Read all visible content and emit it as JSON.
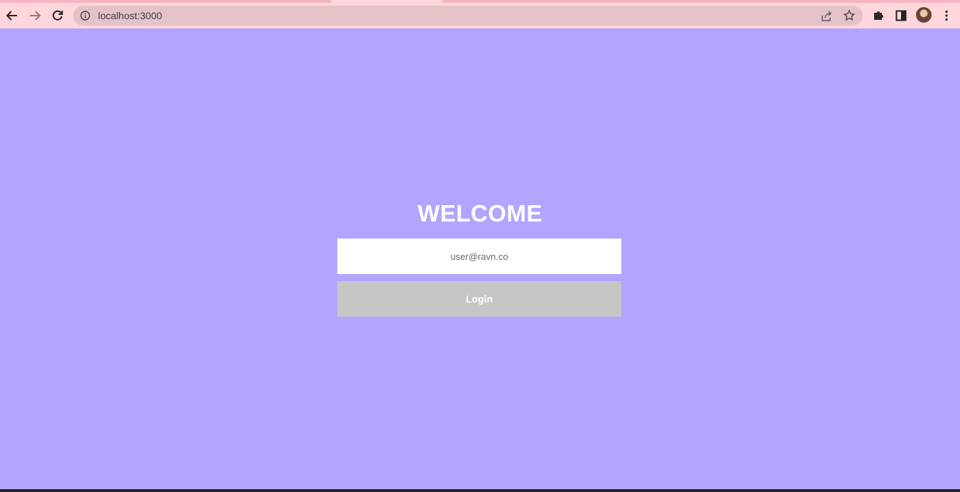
{
  "browser": {
    "url": "localhost:3000",
    "icons": {
      "back": "back-arrow-icon",
      "forward": "forward-arrow-icon",
      "reload": "reload-icon",
      "site_info": "info-icon",
      "share": "share-icon",
      "bookmark": "star-icon",
      "extensions": "puzzle-icon",
      "side_panel": "side-panel-icon",
      "menu": "kebab-menu-icon"
    },
    "colors": {
      "toolbar": "#ffd6dc",
      "omnibox": "#e4c3c8"
    }
  },
  "page": {
    "background": "#b3a4ff",
    "title": "WELCOME",
    "email_placeholder": "user@ravn.co",
    "login_label": "Login",
    "login_button_color": "#c6c6c6"
  }
}
